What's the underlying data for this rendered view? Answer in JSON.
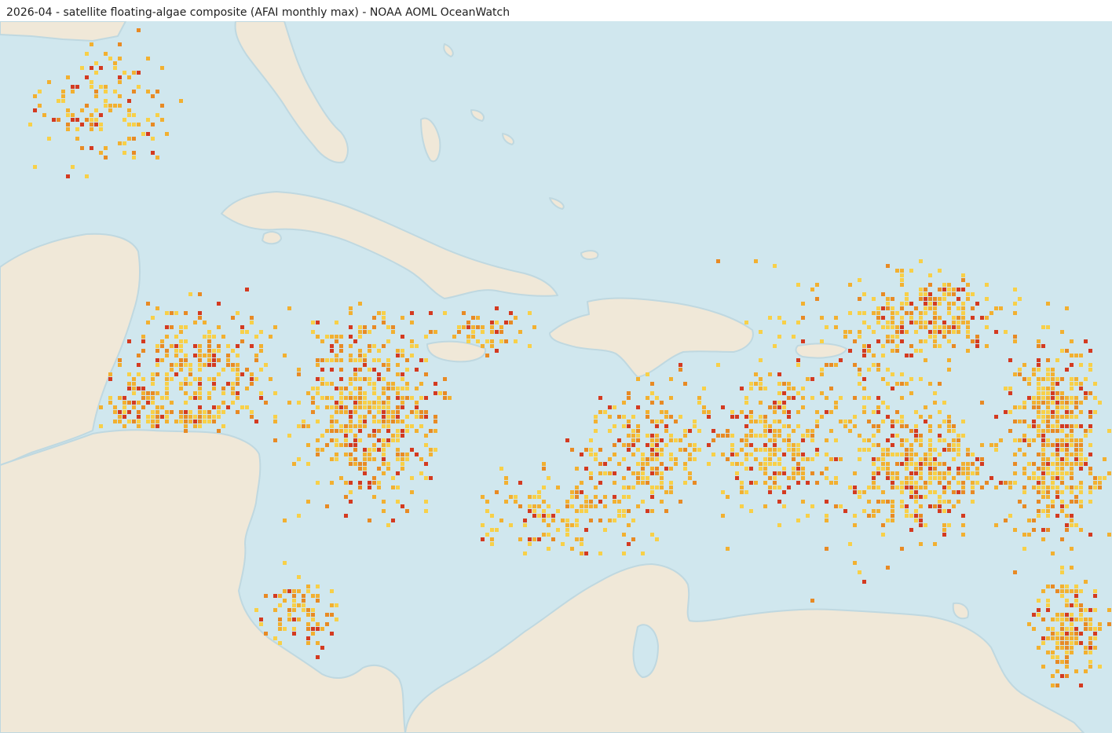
{
  "title": "2026-04 - satellite floating-algae composite (AFAI monthly max) - NOAA AOML OceanWatch",
  "colors": {
    "ocean": "#d0e7ee",
    "land": "#f0e8d8",
    "coast": "#bfd8e0",
    "algae_low": "#f8d048",
    "algae_mid": "#f2b030",
    "algae_high": "#e88a24",
    "algae_max": "#d43a20"
  }
}
